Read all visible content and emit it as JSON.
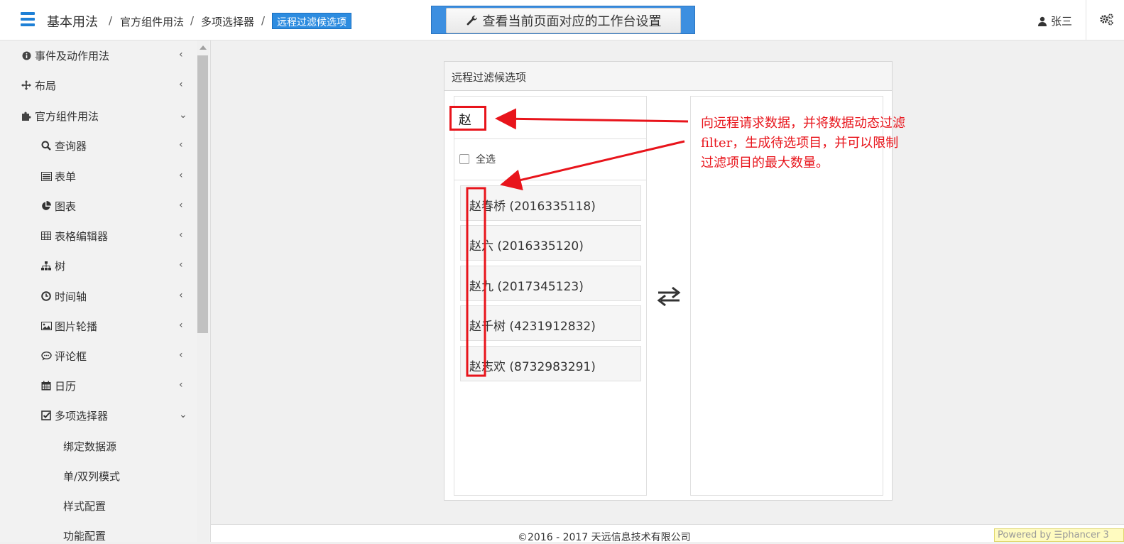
{
  "header": {
    "app_title": "基本用法",
    "breadcrumbs": [
      "官方组件用法",
      "多项选择器"
    ],
    "breadcrumb_separator": "/",
    "current_page": "远程过滤候选项",
    "workbench_button": "查看当前页面对应的工作台设置",
    "user_name": "张三",
    "icons": {
      "menu": "hamburger-icon",
      "workbench": "wrench-icon",
      "user": "user-icon",
      "settings": "gears-icon"
    }
  },
  "sidebar": {
    "items": [
      {
        "label": "事件及动作用法",
        "icon": "info-circle-icon",
        "level": 1,
        "chevron": "‹"
      },
      {
        "label": "布局",
        "icon": "move-icon",
        "level": 1,
        "chevron": "‹"
      },
      {
        "label": "官方组件用法",
        "icon": "puzzle-icon",
        "level": 1,
        "chevron": "⌄"
      },
      {
        "label": "查询器",
        "icon": "search-icon",
        "level": 2,
        "chevron": "‹"
      },
      {
        "label": "表单",
        "icon": "list-alt-icon",
        "level": 2,
        "chevron": "‹"
      },
      {
        "label": "图表",
        "icon": "pie-chart-icon",
        "level": 2,
        "chevron": "‹"
      },
      {
        "label": "表格编辑器",
        "icon": "table-icon",
        "level": 2,
        "chevron": "‹"
      },
      {
        "label": "树",
        "icon": "sitemap-icon",
        "level": 2,
        "chevron": "‹"
      },
      {
        "label": "时间轴",
        "icon": "clock-icon",
        "level": 2,
        "chevron": "‹"
      },
      {
        "label": "图片轮播",
        "icon": "image-icon",
        "level": 2,
        "chevron": "‹"
      },
      {
        "label": "评论框",
        "icon": "comment-icon",
        "level": 2,
        "chevron": "‹"
      },
      {
        "label": "日历",
        "icon": "calendar-icon",
        "level": 2,
        "chevron": "‹"
      },
      {
        "label": "多项选择器",
        "icon": "check-square-icon",
        "level": 2,
        "chevron": "⌄"
      },
      {
        "label": "绑定数据源",
        "icon": "",
        "level": 3,
        "chevron": ""
      },
      {
        "label": "单/双列模式",
        "icon": "",
        "level": 3,
        "chevron": ""
      },
      {
        "label": "样式配置",
        "icon": "",
        "level": 3,
        "chevron": ""
      },
      {
        "label": "功能配置",
        "icon": "",
        "level": 3,
        "chevron": ""
      }
    ]
  },
  "panel": {
    "title": "远程过滤候选项",
    "search_value": "赵",
    "select_all_label": "全选",
    "options": [
      "赵春桥 (2016335118)",
      "赵六 (2016335120)",
      "赵九 (2017345123)",
      "赵千树 (4231912832)",
      "赵志欢 (8732983291)"
    ],
    "selected_options": [],
    "swap_icon": "exchange-icon"
  },
  "annotation": {
    "text": "向远程请求数据，并将数据动态过滤 filter，生成待选项目，并可以限制过滤项目的最大数量。",
    "color": "#e8141b"
  },
  "footer": {
    "copyright": "©2016 - 2017 天远信息技术有限公司",
    "powered_by": "Powered by ☰phancer 3"
  },
  "colors": {
    "accent": "#2d8ce0",
    "annotation_red": "#e8141b"
  }
}
